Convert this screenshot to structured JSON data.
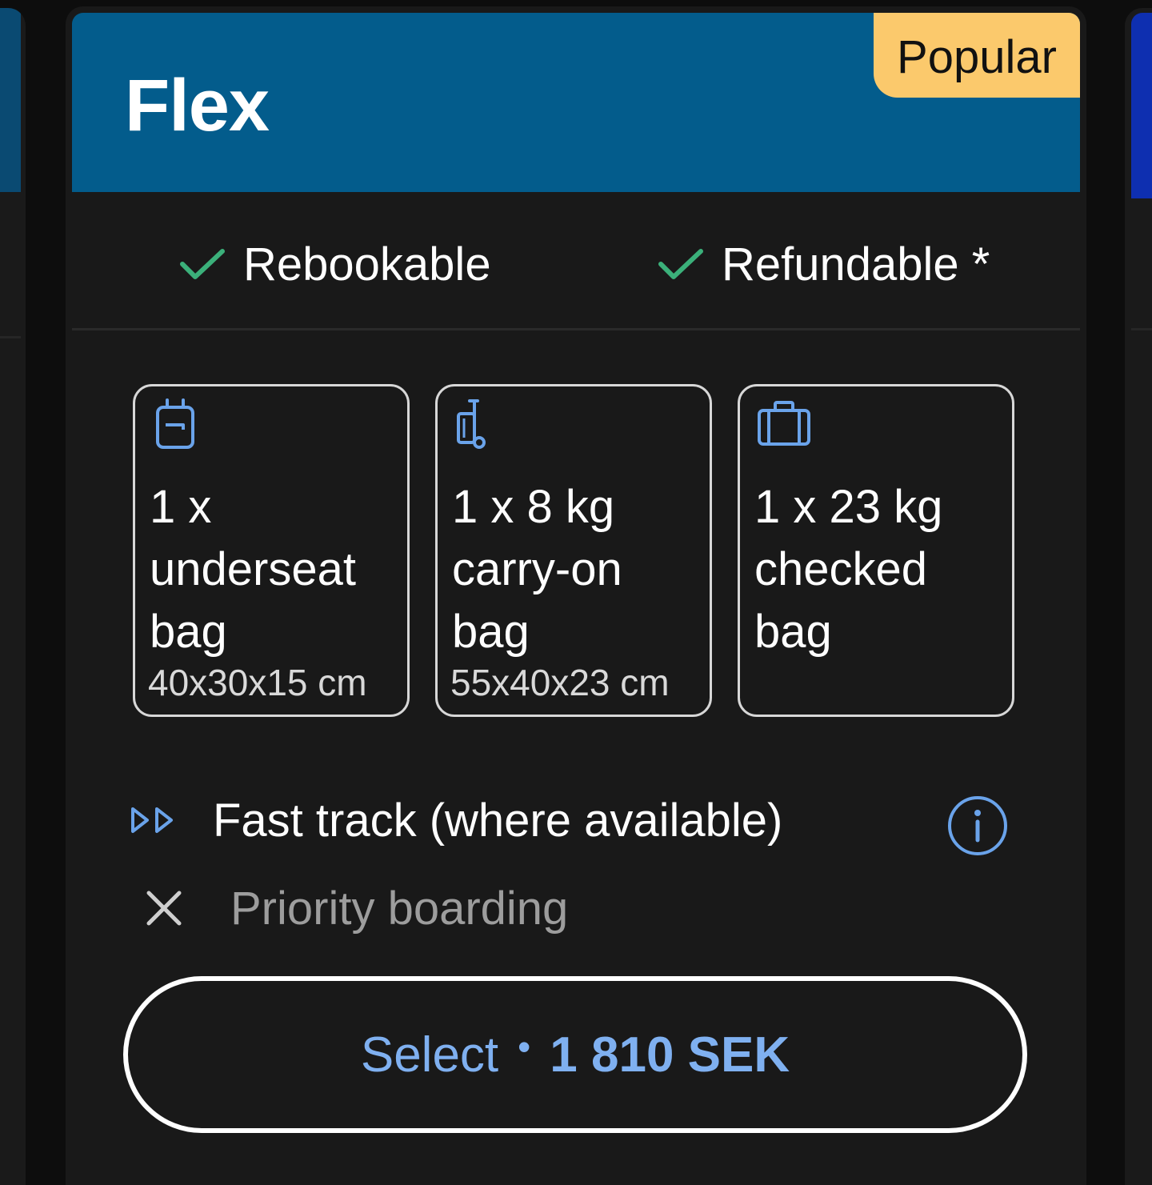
{
  "card": {
    "title": "Flex",
    "badge": "Popular",
    "header_color": "#035c8c",
    "badge_color": "#fbc96c"
  },
  "features": [
    {
      "label": "Rebookable",
      "icon": "check-icon"
    },
    {
      "label": "Refundable *",
      "icon": "check-icon"
    }
  ],
  "bags": [
    {
      "icon": "underseat-bag-icon",
      "description": "1 x underseat bag",
      "dimensions": "40x30x15 cm"
    },
    {
      "icon": "carry-on-bag-icon",
      "description": "1 x 8 kg carry-on bag",
      "dimensions": "55x40x23 cm"
    },
    {
      "icon": "checked-bag-icon",
      "description": "1 x 23 kg checked bag",
      "dimensions": ""
    }
  ],
  "extras": {
    "fast_track": {
      "label": "Fast track (where available)",
      "icon": "fast-forward-icon",
      "included": true
    },
    "priority_boarding": {
      "label": "Priority boarding",
      "icon": "close-icon",
      "included": false
    }
  },
  "select_button": {
    "label": "Select",
    "separator": "•",
    "price": "1 810 SEK",
    "color": "#7fb0f0"
  },
  "colors": {
    "accent_icon": "#6aa3ea",
    "check": "#3bb07a",
    "background": "#191919"
  }
}
